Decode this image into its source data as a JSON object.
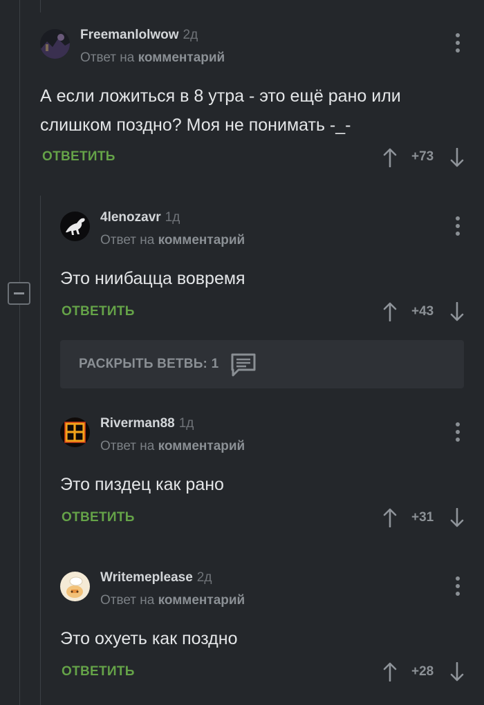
{
  "comments": [
    {
      "author": "Freemanlolwow",
      "time": "2д",
      "reply_prefix": "Ответ на",
      "reply_link": "комментарий",
      "text_lines": [
        "А если ложиться в 8 утра - это ещё рано или",
        "слишком поздно? Моя не понимать -_-"
      ],
      "reply_label": "ОТВЕТИТЬ",
      "rating": "+73",
      "avatar_icon": "dark-landscape-avatar"
    },
    {
      "author": "4lenozavr",
      "time": "1д",
      "reply_prefix": "Ответ на",
      "reply_link": "комментарий",
      "text_lines": [
        "Это ниибацца вовремя"
      ],
      "reply_label": "ОТВЕТИТЬ",
      "rating": "+43",
      "avatar_icon": "dinosaur-avatar"
    },
    {
      "author": "Riverman88",
      "time": "1д",
      "reply_prefix": "Ответ на",
      "reply_link": "комментарий",
      "text_lines": [
        "Это пиздец как рано"
      ],
      "reply_label": "ОТВЕТИТЬ",
      "rating": "+31",
      "avatar_icon": "rammstein-logo-avatar"
    },
    {
      "author": "Writemeplease",
      "time": "2д",
      "reply_prefix": "Ответ на",
      "reply_link": "комментарий",
      "text_lines": [
        "Это охуеть как поздно"
      ],
      "reply_label": "ОТВЕТИТЬ",
      "rating": "+28",
      "avatar_icon": "cartoon-avatar"
    }
  ],
  "expand_branch": {
    "label": "РАСКРЫТЬ ВЕТВЬ: 1",
    "icon": "comment-icon"
  },
  "colors": {
    "background": "#24272b",
    "accent_green": "#65a348",
    "text": "#e4e6e8",
    "muted": "#7b8085"
  }
}
